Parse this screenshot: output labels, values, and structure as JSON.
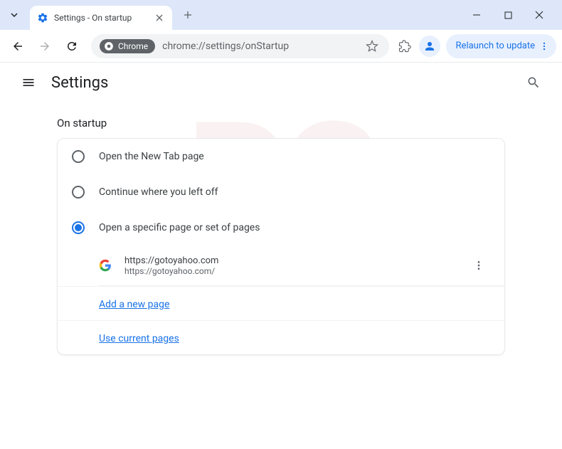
{
  "window": {
    "tab_title": "Settings - On startup"
  },
  "toolbar": {
    "chrome_chip": "Chrome",
    "url": "chrome://settings/onStartup",
    "relaunch_label": "Relaunch to update"
  },
  "header": {
    "title": "Settings"
  },
  "section": {
    "title": "On startup",
    "options": [
      {
        "label": "Open the New Tab page",
        "selected": false
      },
      {
        "label": "Continue where you left off",
        "selected": false
      },
      {
        "label": "Open a specific page or set of pages",
        "selected": true
      }
    ],
    "pages": [
      {
        "title": "https://gotoyahoo.com",
        "url": "https://gotoyahoo.com/"
      }
    ],
    "add_page_label": "Add a new page",
    "use_current_label": "Use current pages"
  }
}
